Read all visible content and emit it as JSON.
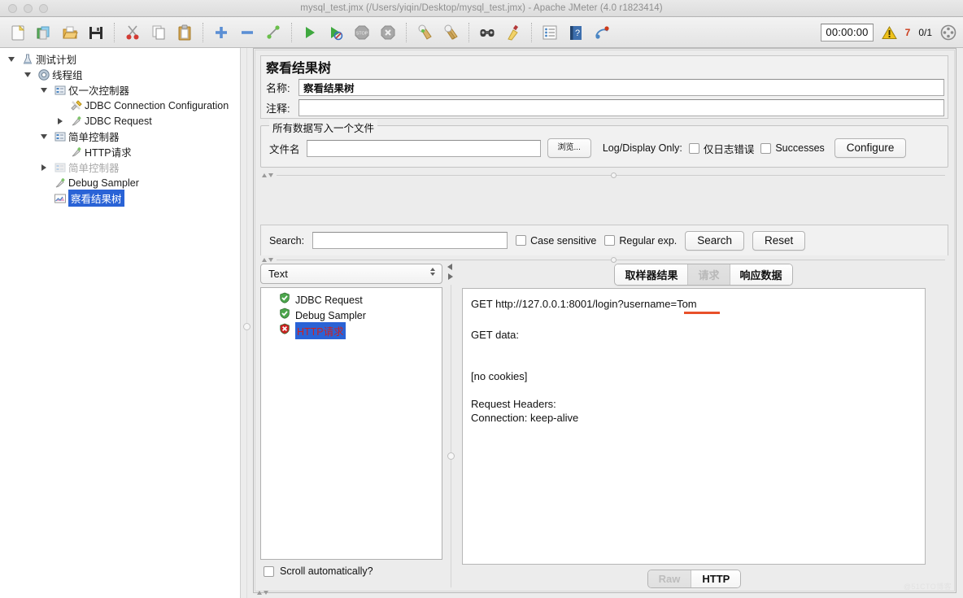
{
  "window": {
    "title": "mysql_test.jmx (/Users/yiqin/Desktop/mysql_test.jmx) - Apache JMeter (4.0 r1823414)"
  },
  "toolbar": {
    "icons": [
      {
        "name": "new-icon",
        "label": "New"
      },
      {
        "name": "templates-icon",
        "label": "Templates"
      },
      {
        "name": "open-icon",
        "label": "Open"
      },
      {
        "name": "save-icon",
        "label": "Save"
      },
      {
        "name": "cut-icon",
        "label": "Cut"
      },
      {
        "name": "copy-icon",
        "label": "Copy"
      },
      {
        "name": "paste-icon",
        "label": "Paste"
      },
      {
        "name": "expand-icon",
        "label": "Expand all"
      },
      {
        "name": "collapse-icon",
        "label": "Collapse all"
      },
      {
        "name": "toggle-icon",
        "label": "Toggle"
      },
      {
        "name": "start-icon",
        "label": "Start"
      },
      {
        "name": "start-no-timers-icon",
        "label": "Start no pauses"
      },
      {
        "name": "stop-icon",
        "label": "Stop"
      },
      {
        "name": "shutdown-icon",
        "label": "Shutdown"
      },
      {
        "name": "clear-icon",
        "label": "Clear"
      },
      {
        "name": "clear-all-icon",
        "label": "Clear all"
      },
      {
        "name": "search-icon",
        "label": "Search"
      },
      {
        "name": "search-reset-icon",
        "label": "Reset search"
      },
      {
        "name": "function-helper-icon",
        "label": "Function helper"
      },
      {
        "name": "help-icon",
        "label": "Help"
      },
      {
        "name": "undo-redo-icon",
        "label": "Undo"
      }
    ],
    "timer": "00:00:00",
    "warning_count": "7",
    "thread_count": "0/1",
    "warning_color": "#cc3b1a"
  },
  "tree": {
    "nodes": [
      {
        "label": "测试计划",
        "indent": 0,
        "twisty": "down",
        "icon": "test-plan-icon",
        "state": "normal"
      },
      {
        "label": "线程组",
        "indent": 1,
        "twisty": "down",
        "icon": "thread-group-icon",
        "state": "normal"
      },
      {
        "label": "仅一次控制器",
        "indent": 2,
        "twisty": "down",
        "icon": "controller-icon",
        "state": "normal"
      },
      {
        "label": "JDBC Connection Configuration",
        "indent": 3,
        "twisty": "none",
        "icon": "config-element-icon",
        "state": "normal"
      },
      {
        "label": "JDBC Request",
        "indent": 3,
        "twisty": "right",
        "icon": "sampler-icon",
        "state": "normal"
      },
      {
        "label": "简单控制器",
        "indent": 2,
        "twisty": "down",
        "icon": "controller-icon",
        "state": "normal"
      },
      {
        "label": "HTTP请求",
        "indent": 3,
        "twisty": "none",
        "icon": "sampler-icon",
        "state": "normal"
      },
      {
        "label": "简单控制器",
        "indent": 2,
        "twisty": "right",
        "icon": "controller-icon",
        "state": "disabled"
      },
      {
        "label": "Debug Sampler",
        "indent": 2,
        "twisty": "none",
        "icon": "sampler-icon",
        "state": "normal"
      },
      {
        "label": "察看结果树",
        "indent": 2,
        "twisty": "none",
        "icon": "view-results-tree-icon",
        "state": "selected"
      }
    ],
    "selection_color": "#2a63d6"
  },
  "panel": {
    "title": "察看结果树",
    "name_label": "名称:",
    "name_value": "察看结果树",
    "comment_label": "注释:",
    "comment_value": "",
    "filegroup": {
      "legend": "所有数据写入一个文件",
      "filename_label": "文件名",
      "filename_value": "",
      "browse_button": "浏览...",
      "log_display_label": "Log/Display Only:",
      "errors_only_checkbox": "仅日志错误",
      "errors_only_checked": false,
      "successes_checkbox": "Successes",
      "successes_checked": false,
      "configure_button": "Configure"
    },
    "search": {
      "label": "Search:",
      "value": "",
      "case_sensitive_label": "Case sensitive",
      "case_sensitive_checked": false,
      "regex_label": "Regular exp.",
      "regex_checked": false,
      "search_button": "Search",
      "reset_button": "Reset"
    }
  },
  "results": {
    "renderer_selected": "Text",
    "items": [
      {
        "label": "JDBC Request",
        "status": "success"
      },
      {
        "label": "Debug Sampler",
        "status": "success"
      },
      {
        "label": "HTTP请求",
        "status": "error",
        "selected": true
      }
    ],
    "scroll_label": "Scroll automatically?",
    "scroll_checked": false,
    "success_color": "#4ca64c",
    "error_color": "#cc2222"
  },
  "detail": {
    "tabs": [
      {
        "label": "取样器结果",
        "active": false
      },
      {
        "label": "请求",
        "active": true
      },
      {
        "label": "响应数据",
        "active": false
      }
    ],
    "content_lines": [
      "GET http://127.0.0.1:8001/login?username=Tom",
      "",
      "GET data:",
      "",
      "",
      "[no cookies]",
      "",
      "Request Headers:",
      "Connection: keep-alive"
    ],
    "annotation_color": "#e8502a",
    "view_buttons": [
      {
        "label": "Raw",
        "active": false
      },
      {
        "label": "HTTP",
        "active": true
      }
    ]
  },
  "watermark": "@51CTO博客"
}
